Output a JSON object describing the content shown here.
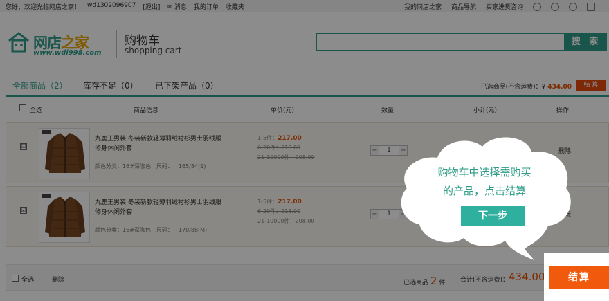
{
  "topbar": {
    "welcome": "您好，欢迎光临网店之家！",
    "username": "wd1302096907",
    "logout": "[退出]",
    "messages": "消息",
    "orders": "我的订单",
    "favorites": "收藏夹",
    "my_store": "我的网店之家",
    "product_nav": "商品导航",
    "buyer_consult": "买家进货咨询"
  },
  "logo": {
    "brand_part1": "网店",
    "brand_part2": "之家",
    "url": "www.wdi998.com"
  },
  "header": {
    "title": "购物车",
    "subtitle": "shopping cart"
  },
  "search": {
    "placeholder": "",
    "button_label": "搜 索"
  },
  "tabs": [
    {
      "label": "全部商品（2）"
    },
    {
      "label": "库存不足（0）"
    },
    {
      "label": "已下架产品（0）"
    }
  ],
  "selection_summary": {
    "label": "已选商品(不含运费)：",
    "currency": "¥",
    "amount": "434.00",
    "checkout_label": "结 算"
  },
  "columns": {
    "select_all": "全选",
    "product_info": "商品信息",
    "unit_price": "单价(元)",
    "quantity": "数量",
    "subtotal": "小计(元)",
    "actions": "操作"
  },
  "items": [
    {
      "checked": "☑",
      "name": "九鹿王男装 冬装新款轻薄羽绒衬衫男士羽绒服修身休闲外套",
      "color_label": "颜色分类：16#深咖色",
      "size_label": "尺码：",
      "size_value": "165/84(S)",
      "tier1_label": "1-5件：",
      "tier1_price": "217.00",
      "tier2": "6-20件：213.00",
      "tier3": "21-10000件：208.00",
      "qty": "1",
      "delete_label": "删除"
    },
    {
      "checked": "☑",
      "name": "九鹿王男装 冬装新款轻薄羽绒衬衫男士羽绒服修身休闲外套",
      "color_label": "颜色分类：16#深咖色",
      "size_label": "尺码：",
      "size_value": "170/88(M)",
      "tier1_label": "1-5件：",
      "tier1_price": "217.00",
      "tier2": "6-20件：213.00",
      "tier3": "21-10000件：208.00",
      "qty": "1",
      "delete_label": "删除"
    }
  ],
  "bottom": {
    "select_all": "全选",
    "delete": "删除",
    "selected_prefix": "已选商品",
    "selected_count": "2",
    "selected_suffix": "件",
    "total_label": "合计(不含运费)：",
    "total_amount": "434.00",
    "checkout_label": "结算"
  },
  "guide": {
    "line1": "购物车中选择需购买",
    "line2": "的产品，点击结算",
    "next_label": "下一步"
  },
  "colors": {
    "brand_green": "#2f9c88",
    "accent_orange": "#f15a0c",
    "overlay": "rgba(0,0,0,0.45)"
  }
}
